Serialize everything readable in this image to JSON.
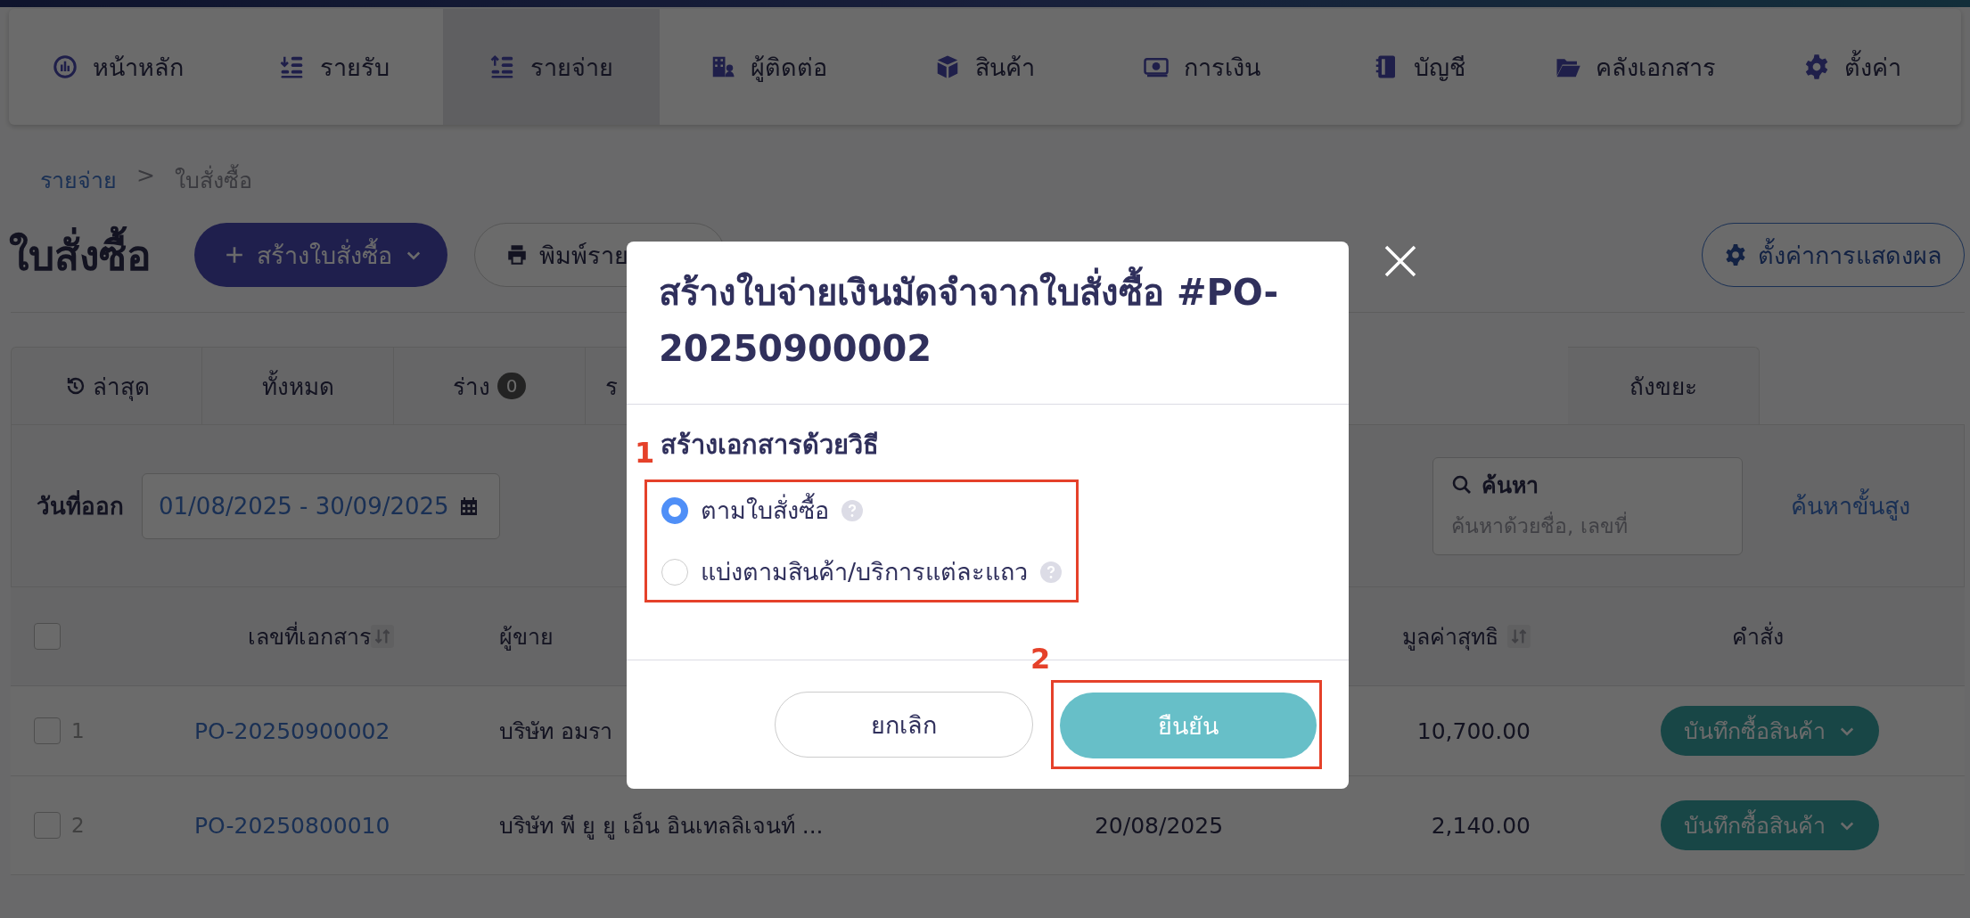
{
  "nav": {
    "items": [
      {
        "label": "หน้าหลัก",
        "kind": "home",
        "selected": false
      },
      {
        "label": "รายรับ",
        "kind": "income",
        "selected": false
      },
      {
        "label": "รายจ่าย",
        "kind": "expense",
        "selected": true
      },
      {
        "label": "ผู้ติดต่อ",
        "kind": "contacts",
        "selected": false
      },
      {
        "label": "สินค้า",
        "kind": "products",
        "selected": false
      },
      {
        "label": "การเงิน",
        "kind": "finance",
        "selected": false
      },
      {
        "label": "บัญชี",
        "kind": "accounts",
        "selected": false
      },
      {
        "label": "คลังเอกสาร",
        "kind": "documents",
        "selected": false
      },
      {
        "label": "ตั้งค่า",
        "kind": "settings",
        "selected": false
      }
    ]
  },
  "breadcrumb": {
    "link": "รายจ่าย",
    "separator": ">",
    "current": "ใบสั่งซื้อ"
  },
  "page": {
    "title": "ใบสั่งซื้อ",
    "create_button": "สร้างใบสั่งซื้อ",
    "print_button": "พิมพ์ราย",
    "display_settings_button": "ตั้งค่าการแสดงผล"
  },
  "status_tabs": [
    {
      "label": "ล่าสุด",
      "kind": "history"
    },
    {
      "label": "ทั้งหมด",
      "kind": "plain"
    },
    {
      "label": "ร่าง",
      "kind": "count",
      "count": "0"
    },
    {
      "label": "ร",
      "kind": "cut"
    },
    {
      "label": "ถังขยะ",
      "kind": "plain"
    }
  ],
  "filter": {
    "date_label": "วันที่ออก",
    "date_range": "01/08/2025 - 30/09/2025",
    "search_label": "ค้นหา",
    "search_placeholder": "ค้นหาด้วยชื่อ, เลขที่",
    "advanced_search": "ค้นหาขั้นสูง"
  },
  "table": {
    "select_all_checked": false,
    "columns": [
      {
        "label": "เลขที่เอกสาร",
        "kind": "sortable"
      },
      {
        "label": "ผู้ขาย",
        "kind": "plain"
      },
      {
        "label": "มูลค่าสุทธิ",
        "kind": "sortable"
      },
      {
        "label": "คำสั่ง",
        "kind": "plain"
      }
    ],
    "rows": [
      {
        "checked": false,
        "index": "1",
        "number": "PO-20250900002",
        "vendor": "บริษัท อมรา",
        "net": "10,700.00",
        "action": "บันทึกซื้อสินค้า"
      },
      {
        "checked": false,
        "index": "2",
        "number": "PO-20250800010",
        "vendor": "บริษัท พี ยู ยู เอ็น อินเทลลิเจนท์ ...",
        "date": "20/08/2025",
        "net": "2,140.00",
        "action": "บันทึกซื้อสินค้า"
      }
    ]
  },
  "modal": {
    "title": "สร้างใบจ่ายเงินมัดจำจากใบสั่งซื้อ #PO-20250900002",
    "section_label": "สร้างเอกสารด้วยวิธี",
    "options": [
      {
        "label": "ตามใบสั่งซื้อ",
        "selected": true
      },
      {
        "label": "แบ่งตามสินค้า/บริการแต่ละแถว",
        "selected": false
      }
    ],
    "cancel": "ยกเลิก",
    "confirm": "ยืนยัน",
    "annotations": [
      {
        "label": "1"
      },
      {
        "label": "2"
      }
    ]
  }
}
